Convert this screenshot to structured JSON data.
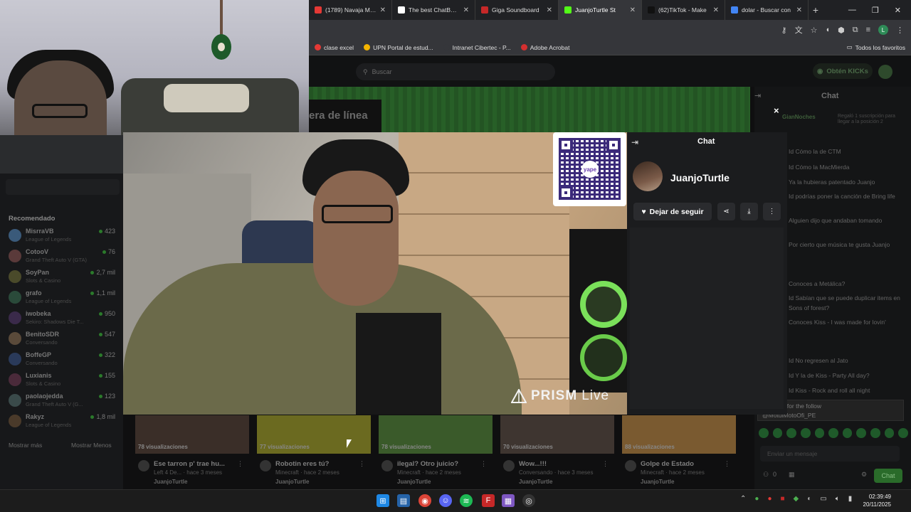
{
  "browser": {
    "tabs": [
      {
        "title": "(1789) Navaja Mari",
        "color": "#e53935",
        "active": false
      },
      {
        "title": "The best ChatBot e",
        "color": "#ffffff",
        "active": false
      },
      {
        "title": "Giga Soundboard",
        "color": "#c62828",
        "active": false
      },
      {
        "title": "JuanjoTurtle St",
        "color": "#53fc18",
        "active": true
      },
      {
        "title": "(62)TikTok - Make",
        "color": "#111111",
        "active": false
      },
      {
        "title": "dolar - Buscar con",
        "color": "#4285f4",
        "active": false
      }
    ],
    "new_tab": "+",
    "profile_letter": "L",
    "bookmarks": [
      {
        "label": "clase excel",
        "color": "#e53935"
      },
      {
        "label": "UPN Portal de estud...",
        "color": "#f4b400"
      },
      {
        "label": "Intranet Cibertec - P...",
        "color": "#35363a"
      },
      {
        "label": "Adobe Acrobat",
        "color": "#d32f2f"
      }
    ],
    "all_bookmarks": "Todos los favoritos"
  },
  "kick": {
    "search_placeholder": "Buscar",
    "kicks_button": "Obtén KICKs",
    "banner_text": "era de línea",
    "sidebar": {
      "section_title": "Recomendado",
      "streamers": [
        {
          "name": "MisrraVB",
          "game": "League of Legends",
          "viewers": "423"
        },
        {
          "name": "CotooV",
          "game": "Grand Theft Auto V (GTA)",
          "viewers": "76"
        },
        {
          "name": "SoyPan",
          "game": "Slots & Casino",
          "viewers": "2,7 mil"
        },
        {
          "name": "grafo",
          "game": "League of Legends",
          "viewers": "1,1 mil"
        },
        {
          "name": "iwobeka",
          "game": "Sekiro: Shadows Die T...",
          "viewers": "950"
        },
        {
          "name": "BenitoSDR",
          "game": "Conversando",
          "viewers": "547"
        },
        {
          "name": "BoffeGP",
          "game": "Conversando",
          "viewers": "322"
        },
        {
          "name": "Luxianis",
          "game": "Slots & Casino",
          "viewers": "155"
        },
        {
          "name": "paolaojedda",
          "game": "Grand Theft Auto V (G...",
          "viewers": "123"
        },
        {
          "name": "Rakyz",
          "game": "League of Legends",
          "viewers": "1,8 mil"
        }
      ],
      "show_more": "Mostrar más",
      "show_less": "Mostrar Menos"
    },
    "chat_bg": {
      "title": "Chat",
      "sub_user": "GianNoches",
      "sub_text": "Regaló 1 suscripción para llegar a la posición 2",
      "messages": [
        "Id Cómo la de CTM",
        "Id Cómo la MacMierda",
        "Ya la hubieras patentado Juanjo",
        "Id podrías poner la canción de Bring life",
        "Alguien dijo que andaban tomando",
        "Por cierto que música te gusta Juanjo",
        "Conoces a Metálica?",
        "Id Sabían que se puede duplicar items en Sons of forest?",
        "Conoces Kiss - I was made for lovin'",
        "Id No regresen al Jato",
        "Id Y la de Kiss - Party All day?",
        "Id Kiss - Rock and roll all night"
      ],
      "thanks_text": ": Thanks for the follow",
      "thanks_user": "@MotulMotoOfi_PE",
      "input_placeholder": "Enviar un mensaje",
      "count": "0",
      "send": "Chat"
    },
    "videos": [
      {
        "views": "78 visualizaciones",
        "title": "Ese tarron p' trae hu...",
        "sub": "Left 4 De... · hace 3 meses",
        "user": "JuanjoTurtle",
        "color": "#3a2e28"
      },
      {
        "views": "77 visualizaciones",
        "title": "Robotin eres tú?",
        "sub": "Minecraft · hace 2 meses",
        "user": "JuanjoTurtle",
        "color": "#6b6a20"
      },
      {
        "views": "78 visualizaciones",
        "title": "ilegal? Otro juicio?",
        "sub": "Minecraft · hace 2 meses",
        "user": "JuanjoTurtle",
        "color": "#3a5a2a"
      },
      {
        "views": "70 visualizaciones",
        "title": "Wow...!!!",
        "sub": "Conversando · hace 3 meses",
        "user": "JuanjoTurtle",
        "color": "#3e3530"
      },
      {
        "views": "88 visualizaciones",
        "title": "Golpe de Estado",
        "sub": "Minecraft · hace 2 meses",
        "user": "JuanjoTurtle",
        "color": "#7a5a30"
      }
    ]
  },
  "overlay": {
    "prism_brand": "PRISM",
    "prism_live": "Live",
    "qr_label": "yape",
    "chat_title": "Chat",
    "streamer_name": "JuanjoTurtle",
    "follow_label": "Dejar de seguir",
    "close": "×"
  },
  "taskbar": {
    "time": "02:39:49",
    "date": "20/11/2025"
  }
}
